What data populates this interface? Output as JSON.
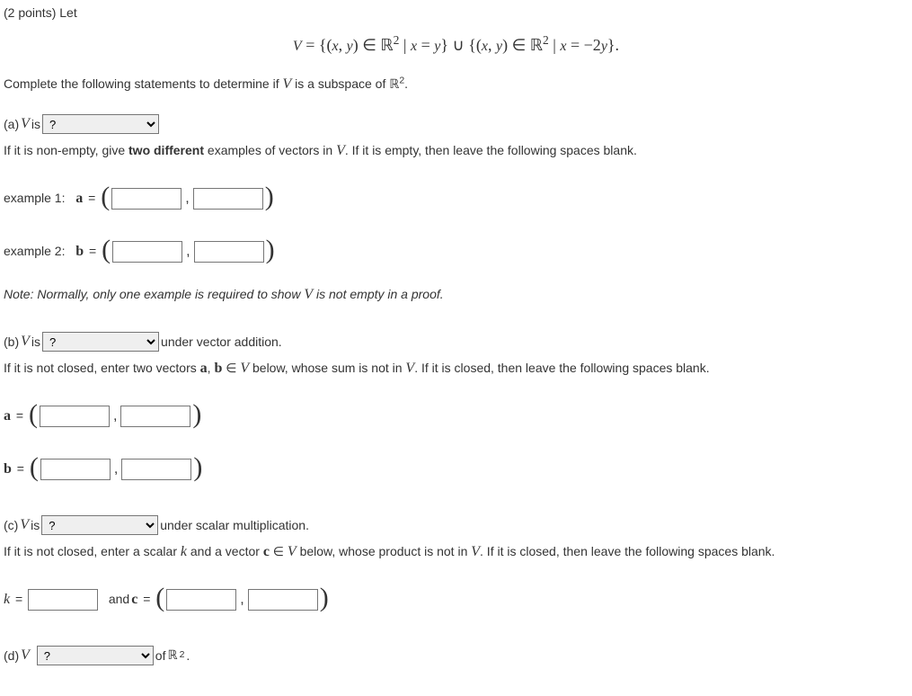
{
  "points": "(2 points) Let",
  "equation": "V = {(x, y) ∈ ℝ² | x = y} ∪ {(x, y) ∈ ℝ² | x = −2y}.",
  "intro": "Complete the following statements to determine if ",
  "intro2": " is a subspace of ",
  "R2": "ℝ²",
  "period": ".",
  "partA": {
    "label": "(a) ",
    "is": " is ",
    "select": "?",
    "line2a": "If it is non-empty, give ",
    "line2b": "two different",
    "line2c": " examples of vectors in ",
    "line2d": ". If it is empty, then leave the following spaces blank.",
    "ex1": "example 1: ",
    "ex2": "example 2: ",
    "a_eq": "a =",
    "b_eq": "b =",
    "note": "Note: Normally, only one example is required to show ",
    "note2": " is not empty in a proof."
  },
  "partB": {
    "label": "(b) ",
    "is": " is ",
    "select": "?",
    "suffix": " under vector addition.",
    "line2a": "If it is not closed, enter two vectors ",
    "line2b": " below, whose sum is not in ",
    "line2c": ". If it is closed, then leave the following spaces blank.",
    "ab": "a, b ∈ V",
    "a_eq": "a =",
    "b_eq": "b ="
  },
  "partC": {
    "label": "(c) ",
    "is": " is ",
    "select": "?",
    "suffix": " under scalar multiplication.",
    "line2a": "If it is not closed, enter a scalar ",
    "line2b": " and a vector ",
    "line2c": " below, whose product is not in ",
    "line2d": ". If it is closed, then leave the following spaces blank.",
    "k": "k",
    "cinV": "c ∈ V",
    "k_eq": "k =",
    "and": " and ",
    "c_eq": "c ="
  },
  "partD": {
    "label": "(d) ",
    "select": "?",
    "of": " of "
  },
  "V": "V"
}
